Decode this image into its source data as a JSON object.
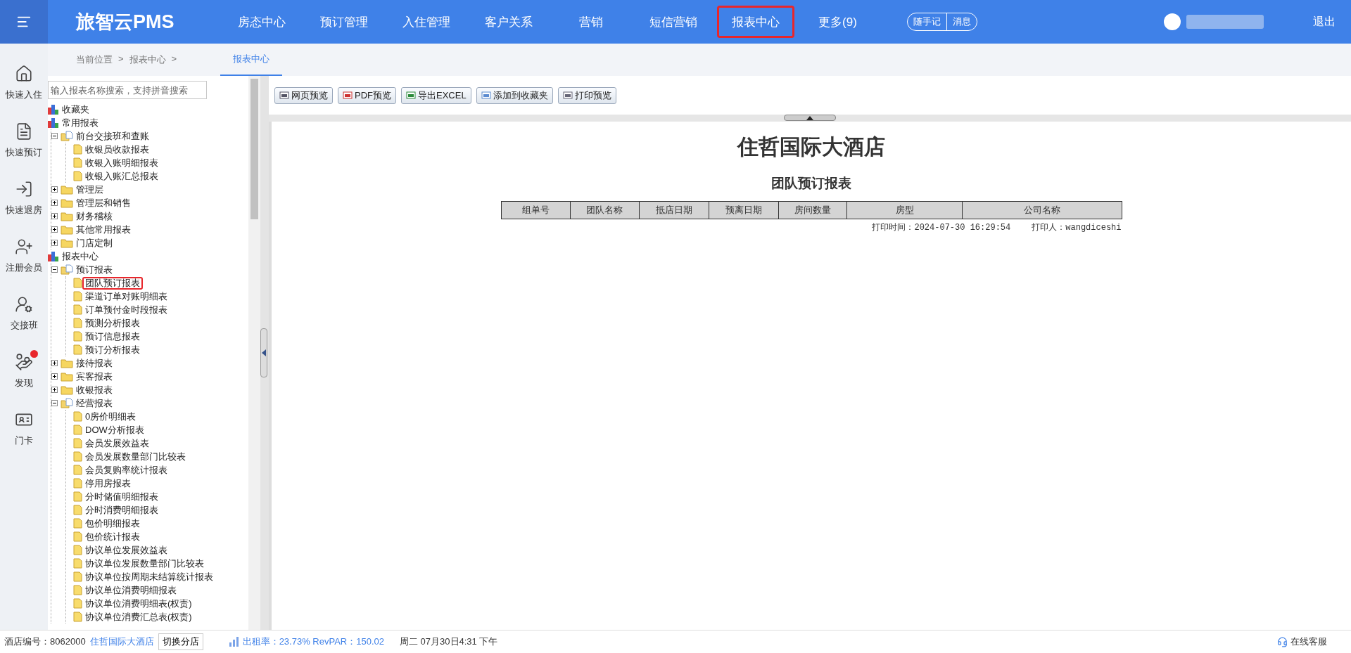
{
  "app": {
    "logo": "旅智云PMS"
  },
  "nav": [
    {
      "label": "房态中心",
      "selected": false
    },
    {
      "label": "预订管理",
      "selected": false
    },
    {
      "label": "入住管理",
      "selected": false
    },
    {
      "label": "客户关系",
      "selected": false
    },
    {
      "label": "营销",
      "selected": false
    },
    {
      "label": "短信营销",
      "selected": false
    },
    {
      "label": "报表中心",
      "selected": true
    },
    {
      "label": "更多(9)",
      "selected": false
    }
  ],
  "header_buttons": [
    "随手记",
    "消息"
  ],
  "logout": "退出",
  "sidebar": [
    {
      "label": "快速入住",
      "kind": "checkin",
      "notify": false
    },
    {
      "label": "快速预订",
      "kind": "booking",
      "notify": false
    },
    {
      "label": "快速退房",
      "kind": "checkout",
      "notify": false
    },
    {
      "label": "注册会员",
      "kind": "member",
      "notify": false
    },
    {
      "label": "交接班",
      "kind": "shift",
      "notify": false
    },
    {
      "label": "发现",
      "kind": "discover",
      "notify": true
    },
    {
      "label": "门卡",
      "kind": "card",
      "notify": false
    }
  ],
  "breadcrumb": {
    "items": [
      "当前位置",
      "报表中心"
    ],
    "separator": ">",
    "tabs": [
      {
        "label": "报表中心",
        "selected": true
      }
    ]
  },
  "tree": {
    "search_placeholder": "输入报表名称搜索，支持拼音搜索",
    "items": [
      {
        "label": "收藏夹",
        "kind": "root"
      },
      {
        "label": "常用报表",
        "kind": "root",
        "children": [
          {
            "label": "前台交接班和查账",
            "kind": "folder",
            "expanded": true,
            "children": [
              {
                "label": "收银员收款报表",
                "kind": "file",
                "selected": false
              },
              {
                "label": "收银入账明细报表",
                "kind": "file",
                "selected": false
              },
              {
                "label": "收银入账汇总报表",
                "kind": "file",
                "selected": false
              }
            ]
          },
          {
            "label": "管理层",
            "kind": "folder",
            "expanded": false
          },
          {
            "label": "管理层和销售",
            "kind": "folder",
            "expanded": false
          },
          {
            "label": "财务稽核",
            "kind": "folder",
            "expanded": false
          },
          {
            "label": "其他常用报表",
            "kind": "folder",
            "expanded": false
          },
          {
            "label": "门店定制",
            "kind": "folder",
            "expanded": false
          }
        ]
      },
      {
        "label": "报表中心",
        "kind": "root",
        "children": [
          {
            "label": "预订报表",
            "kind": "folder",
            "expanded": true,
            "children": [
              {
                "label": "团队预订报表",
                "kind": "file",
                "selected": true
              },
              {
                "label": "渠道订单对账明细表",
                "kind": "file",
                "selected": false
              },
              {
                "label": "订单预付金时段报表",
                "kind": "file",
                "selected": false
              },
              {
                "label": "预测分析报表",
                "kind": "file",
                "selected": false
              },
              {
                "label": "预订信息报表",
                "kind": "file",
                "selected": false
              },
              {
                "label": "预订分析报表",
                "kind": "file",
                "selected": false
              }
            ]
          },
          {
            "label": "接待报表",
            "kind": "folder",
            "expanded": false
          },
          {
            "label": "宾客报表",
            "kind": "folder",
            "expanded": false
          },
          {
            "label": "收银报表",
            "kind": "folder",
            "expanded": false
          },
          {
            "label": "经营报表",
            "kind": "folder",
            "expanded": true,
            "children": [
              {
                "label": "0房价明细表",
                "kind": "file",
                "selected": false
              },
              {
                "label": "DOW分析报表",
                "kind": "file",
                "selected": false
              },
              {
                "label": "会员发展效益表",
                "kind": "file",
                "selected": false
              },
              {
                "label": "会员发展数量部门比较表",
                "kind": "file",
                "selected": false
              },
              {
                "label": "会员复购率统计报表",
                "kind": "file",
                "selected": false
              },
              {
                "label": "停用房报表",
                "kind": "file",
                "selected": false
              },
              {
                "label": "分时储值明细报表",
                "kind": "file",
                "selected": false
              },
              {
                "label": "分时消费明细报表",
                "kind": "file",
                "selected": false
              },
              {
                "label": "包价明细报表",
                "kind": "file",
                "selected": false
              },
              {
                "label": "包价统计报表",
                "kind": "file",
                "selected": false
              },
              {
                "label": "协议单位发展效益表",
                "kind": "file",
                "selected": false
              },
              {
                "label": "协议单位发展数量部门比较表",
                "kind": "file",
                "selected": false
              },
              {
                "label": "协议单位按周期未结算统计报表",
                "kind": "file",
                "selected": false
              },
              {
                "label": "协议单位消费明细报表",
                "kind": "file",
                "selected": false
              },
              {
                "label": "协议单位消费明细表(权责)",
                "kind": "file",
                "selected": false
              },
              {
                "label": "协议单位消费汇总表(权责)",
                "kind": "file",
                "selected": false
              }
            ]
          }
        ]
      }
    ]
  },
  "toolbar": [
    {
      "label": "网页预览",
      "kind": "web"
    },
    {
      "label": "PDF预览",
      "kind": "pdf"
    },
    {
      "label": "导出EXCEL",
      "kind": "excel"
    },
    {
      "label": "添加到收藏夹",
      "kind": "favorite"
    },
    {
      "label": "打印预览",
      "kind": "print"
    }
  ],
  "report": {
    "hotel": "住哲国际大酒店",
    "title": "团队预订报表",
    "columns": [
      "组单号",
      "团队名称",
      "抵店日期",
      "预离日期",
      "房间数量",
      "房型",
      "公司名称"
    ],
    "print_time": "打印时间：2024-07-30 16:29:54",
    "printer": "打印人：wangdiceshi"
  },
  "status_bar": {
    "hotel_no": "酒店编号：8062000",
    "hotel_name": "住哲国际大酒店",
    "switch": "切换分店",
    "occupancy": "出租率：23.73% RevPAR：150.02",
    "datetime": "周二 07月30日4:31 下午",
    "service": "在线客服"
  }
}
